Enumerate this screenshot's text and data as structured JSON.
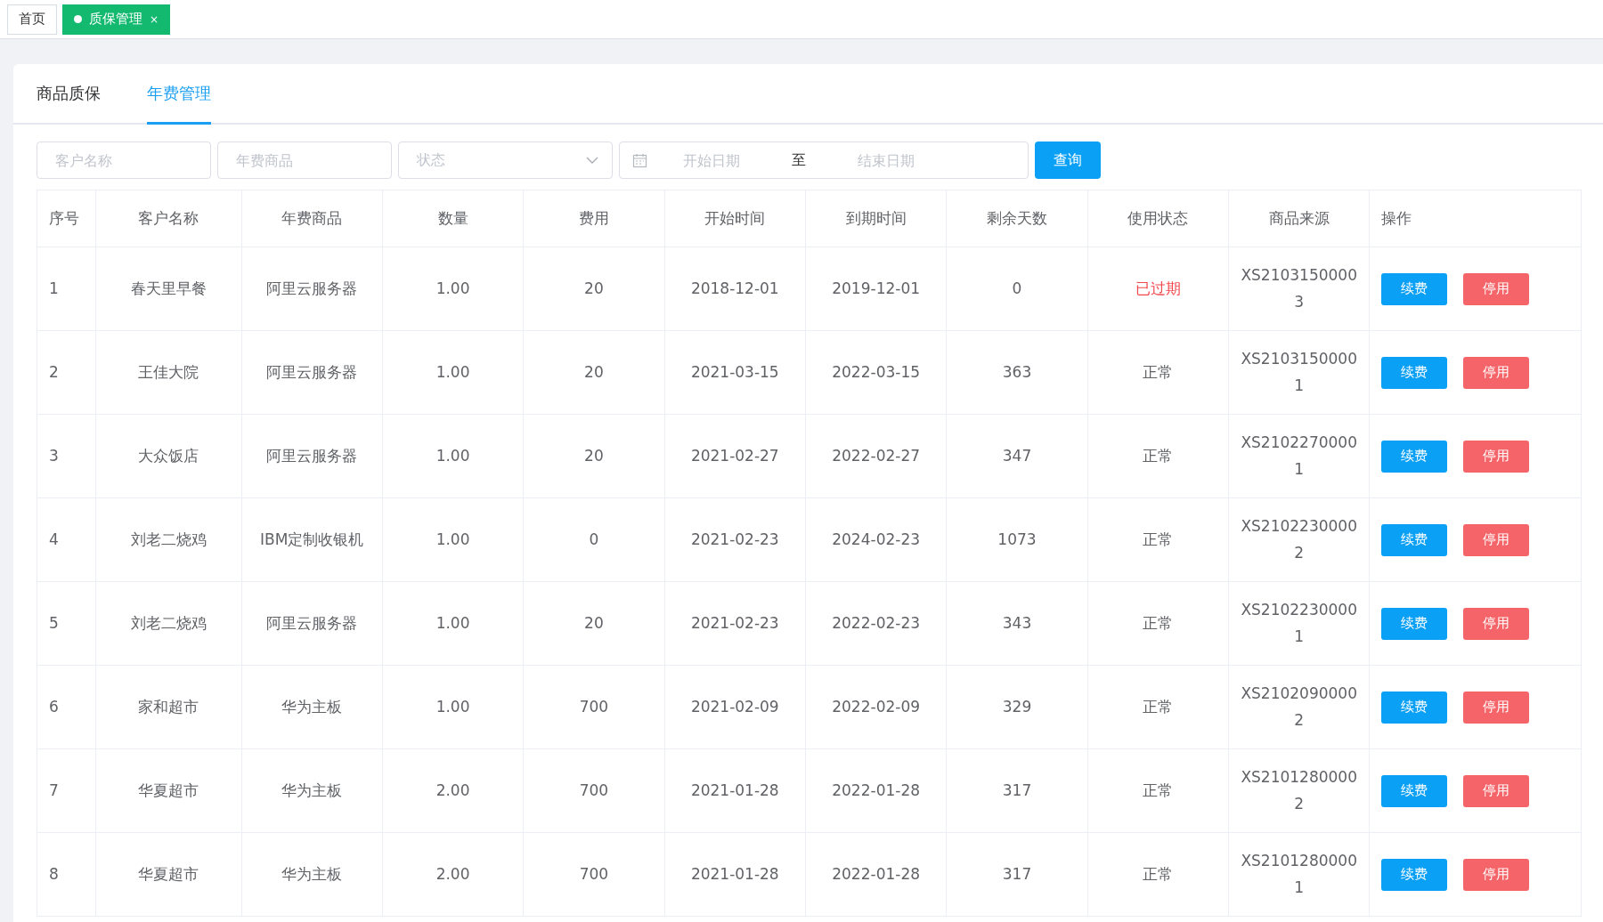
{
  "page_tabs": [
    {
      "label": "首页",
      "selected": false
    },
    {
      "label": "质保管理",
      "selected": true,
      "close": "×"
    }
  ],
  "section_tabs": [
    {
      "label": "商品质保",
      "selected": false
    },
    {
      "label": "年费管理",
      "selected": true
    }
  ],
  "filters": {
    "customer": {
      "placeholder": "客户名称"
    },
    "product": {
      "placeholder": "年费商品"
    },
    "status": {
      "placeholder": "状态"
    },
    "date_range": {
      "start_placeholder": "开始日期",
      "separator": "至",
      "end_placeholder": "结束日期"
    },
    "search_button": "查询"
  },
  "table": {
    "columns": [
      "序号",
      "客户名称",
      "年费商品",
      "数量",
      "费用",
      "开始时间",
      "到期时间",
      "剩余天数",
      "使用状态",
      "商品来源",
      "操作"
    ],
    "rows": [
      {
        "no": "1",
        "customer": "春天里早餐",
        "product": "阿里云服务器",
        "qty": "1.00",
        "fee": "20",
        "start": "2018-12-01",
        "end": "2019-12-01",
        "days": "0",
        "status": "已过期",
        "expired": true,
        "source": "XS21031500003",
        "actions": [
          "续费",
          "停用"
        ]
      },
      {
        "no": "2",
        "customer": "王佳大院",
        "product": "阿里云服务器",
        "qty": "1.00",
        "fee": "20",
        "start": "2021-03-15",
        "end": "2022-03-15",
        "days": "363",
        "status": "正常",
        "expired": false,
        "source": "XS21031500001",
        "actions": [
          "续费",
          "停用"
        ]
      },
      {
        "no": "3",
        "customer": "大众饭店",
        "product": "阿里云服务器",
        "qty": "1.00",
        "fee": "20",
        "start": "2021-02-27",
        "end": "2022-02-27",
        "days": "347",
        "status": "正常",
        "expired": false,
        "source": "XS21022700001",
        "actions": [
          "续费",
          "停用"
        ]
      },
      {
        "no": "4",
        "customer": "刘老二烧鸡",
        "product": "IBM定制收银机",
        "qty": "1.00",
        "fee": "0",
        "start": "2021-02-23",
        "end": "2024-02-23",
        "days": "1073",
        "status": "正常",
        "expired": false,
        "source": "XS21022300002",
        "actions": [
          "续费",
          "停用"
        ]
      },
      {
        "no": "5",
        "customer": "刘老二烧鸡",
        "product": "阿里云服务器",
        "qty": "1.00",
        "fee": "20",
        "start": "2021-02-23",
        "end": "2022-02-23",
        "days": "343",
        "status": "正常",
        "expired": false,
        "source": "XS21022300001",
        "actions": [
          "续费",
          "停用"
        ]
      },
      {
        "no": "6",
        "customer": "家和超市",
        "product": "华为主板",
        "qty": "1.00",
        "fee": "700",
        "start": "2021-02-09",
        "end": "2022-02-09",
        "days": "329",
        "status": "正常",
        "expired": false,
        "source": "XS21020900002",
        "actions": [
          "续费",
          "停用"
        ]
      },
      {
        "no": "7",
        "customer": "华夏超市",
        "product": "华为主板",
        "qty": "2.00",
        "fee": "700",
        "start": "2021-01-28",
        "end": "2022-01-28",
        "days": "317",
        "status": "正常",
        "expired": false,
        "source": "XS21012800002",
        "actions": [
          "续费",
          "停用"
        ]
      },
      {
        "no": "8",
        "customer": "华夏超市",
        "product": "华为主板",
        "qty": "2.00",
        "fee": "700",
        "start": "2021-01-28",
        "end": "2022-01-28",
        "days": "317",
        "status": "正常",
        "expired": false,
        "source": "XS21012800001",
        "actions": [
          "续费",
          "停用"
        ]
      }
    ]
  }
}
